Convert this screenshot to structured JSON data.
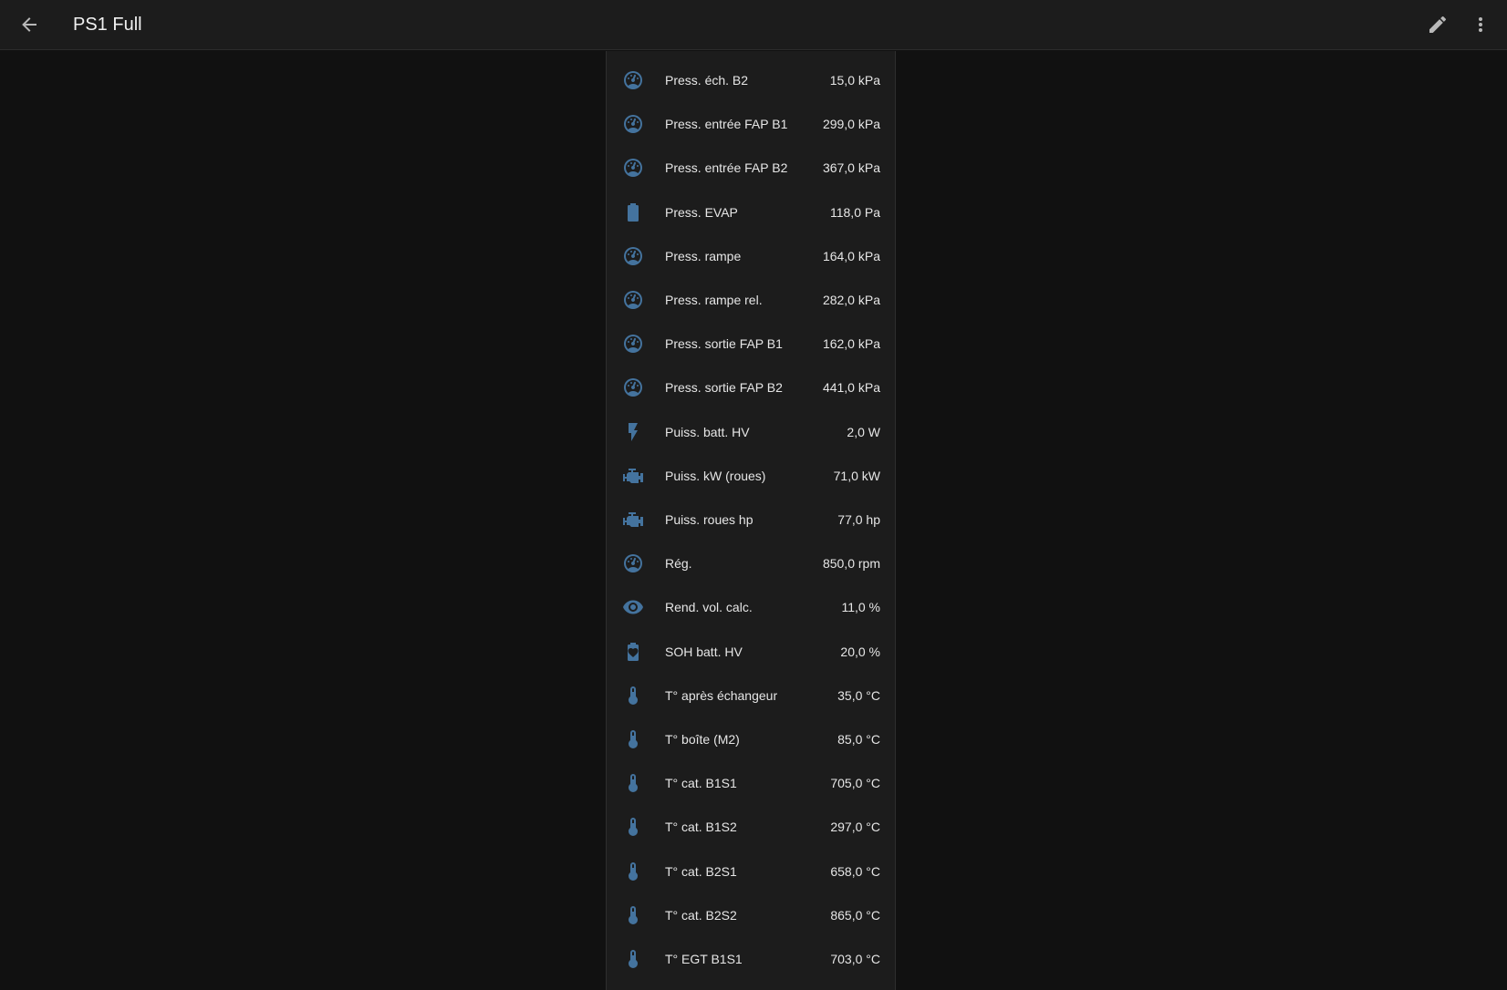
{
  "header": {
    "title": "PS1 Full",
    "back_icon": "arrow-left-icon",
    "edit_icon": "pencil-icon",
    "menu_icon": "dots-vertical-icon"
  },
  "theme": {
    "background": "#111111",
    "toolbar": "#1c1c1c",
    "card": "#1c1c1c",
    "icon_color": "#44739e",
    "text": "#e6e6e6"
  },
  "entities": [
    {
      "icon": "gauge-icon",
      "name": "Press. éch. B2",
      "value": "15,0 kPa"
    },
    {
      "icon": "gauge-icon",
      "name": "Press. entrée FAP B1",
      "value": "299,0 kPa"
    },
    {
      "icon": "gauge-icon",
      "name": "Press. entrée FAP B2",
      "value": "367,0 kPa"
    },
    {
      "icon": "battery-icon",
      "name": "Press. EVAP",
      "value": "118,0 Pa"
    },
    {
      "icon": "gauge-icon",
      "name": "Press. rampe",
      "value": "164,0 kPa"
    },
    {
      "icon": "gauge-icon",
      "name": "Press. rampe rel.",
      "value": "282,0 kPa"
    },
    {
      "icon": "gauge-icon",
      "name": "Press. sortie FAP B1",
      "value": "162,0 kPa"
    },
    {
      "icon": "gauge-icon",
      "name": "Press. sortie FAP B2",
      "value": "441,0 kPa"
    },
    {
      "icon": "flash-icon",
      "name": "Puiss. batt. HV",
      "value": "2,0 W"
    },
    {
      "icon": "engine-icon",
      "name": "Puiss. kW (roues)",
      "value": "71,0 kW"
    },
    {
      "icon": "engine-icon",
      "name": "Puiss. roues hp",
      "value": "77,0 hp"
    },
    {
      "icon": "gauge-icon",
      "name": "Rég.",
      "value": "850,0 rpm"
    },
    {
      "icon": "eye-icon",
      "name": "Rend. vol. calc.",
      "value": "11,0 %"
    },
    {
      "icon": "battery-heart-icon",
      "name": "SOH batt. HV",
      "value": "20,0 %"
    },
    {
      "icon": "thermometer-icon",
      "name": "T° après échangeur",
      "value": "35,0 °C"
    },
    {
      "icon": "thermometer-icon",
      "name": "T° boîte (M2)",
      "value": "85,0 °C"
    },
    {
      "icon": "thermometer-icon",
      "name": "T° cat. B1S1",
      "value": "705,0 °C"
    },
    {
      "icon": "thermometer-icon",
      "name": "T° cat. B1S2",
      "value": "297,0 °C"
    },
    {
      "icon": "thermometer-icon",
      "name": "T° cat. B2S1",
      "value": "658,0 °C"
    },
    {
      "icon": "thermometer-icon",
      "name": "T° cat. B2S2",
      "value": "865,0 °C"
    },
    {
      "icon": "thermometer-icon",
      "name": "T° EGT B1S1",
      "value": "703,0 °C"
    }
  ]
}
